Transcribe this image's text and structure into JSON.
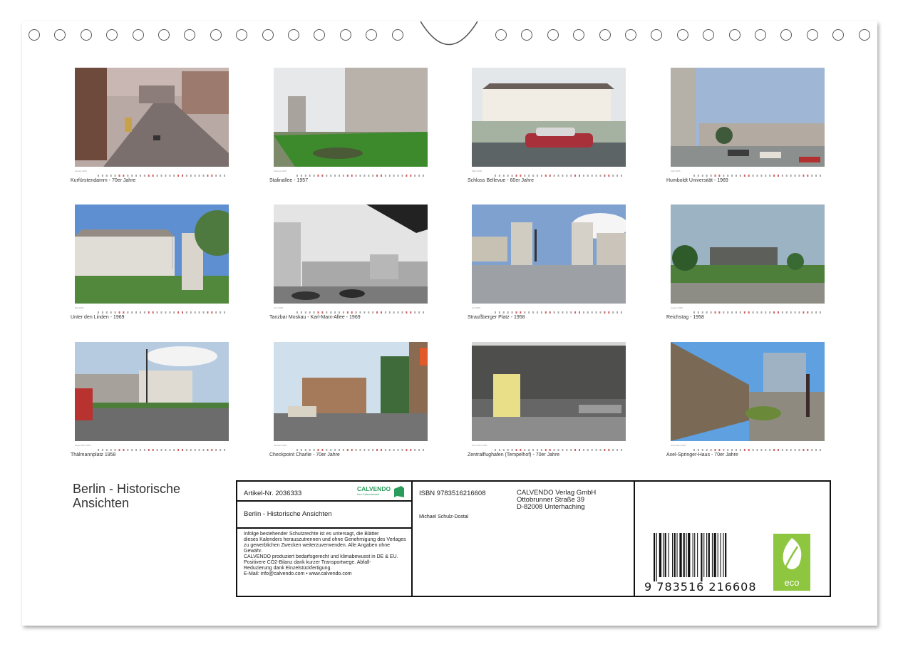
{
  "calendar": {
    "title": "Berlin - Historische Ansichten",
    "title_line1": "Berlin - Historische",
    "title_line2": "Ansichten"
  },
  "months": [
    {
      "label": "Januar 2026",
      "caption": "Kurfürstendamm - 70er Jahre",
      "scene": "street"
    },
    {
      "label": "Februar 2026",
      "caption": "Stalinallee - 1957",
      "scene": "avenue"
    },
    {
      "label": "März 2026",
      "caption": "Schloss Bellevue - 60er Jahre",
      "scene": "palace"
    },
    {
      "label": "April 2026",
      "caption": "Humboldt Universität - 1969",
      "scene": "university"
    },
    {
      "label": "Mai 2026",
      "caption": "Unter den Linden - 1969",
      "scene": "linden"
    },
    {
      "label": "Juni 2026",
      "caption": "Tanzbar Moskau - Karl-Marx-Allee - 1969",
      "scene": "moskau"
    },
    {
      "label": "Juli 2026",
      "caption": "Straußberger Platz - 1958",
      "scene": "platz"
    },
    {
      "label": "August 2026",
      "caption": "Reichstag - 1958",
      "scene": "reichstag"
    },
    {
      "label": "September 2026",
      "caption": "Thälmannplatz 1958",
      "scene": "thaelmann"
    },
    {
      "label": "Oktober 2026",
      "caption": "Checkpoint Charlie - 70er Jahre",
      "scene": "checkpoint"
    },
    {
      "label": "November 2026",
      "caption": "Zentralflughafen (Tempelhof) - 70er Jahre",
      "scene": "tempelhof"
    },
    {
      "label": "Dezember 2026",
      "caption": "Axel-Springer-Haus - 70er Jahre",
      "scene": "springer"
    }
  ],
  "info": {
    "article": "Artikel-Nr. 2036333",
    "brand": "CALVENDO",
    "brand_sub": "Ihre Kalenderwelt",
    "product_title": "Berlin - Historische Ansichten",
    "legal": [
      "Infolge bestehender Schutzrechte ist es untersagt, die Blätter",
      "dieses Kalenders herauszutrennen und ohne Genehmigung des Verlages",
      "zu gewerblichen Zwecken weiterzuverwenden. Alle Angaben ohne",
      "Gewähr.",
      "CALVENDO produziert bedarfsgerecht und klimabewusst in DE & EU.",
      "Positivere CO2-Bilanz dank kurzer Transportwege. Abfall-",
      "Reduzierung dank Einzelstückfertigung.",
      "E-Mail: info@calvendo.com • www.calvendo.com"
    ],
    "isbn": "ISBN 9783516216608",
    "author": "Michael Schulz-Dostal",
    "publisher_name": "CALVENDO Verlag GmbH",
    "publisher_street": "Ottobrunner Straße 39",
    "publisher_city": "D-82008 Unterhaching",
    "barcode_number": "9 783516 216608",
    "eco_label": "eco"
  },
  "colors": {
    "accent_green": "#8ec63f",
    "calvendo_green": "#2a9d5c",
    "border": "#111111"
  }
}
